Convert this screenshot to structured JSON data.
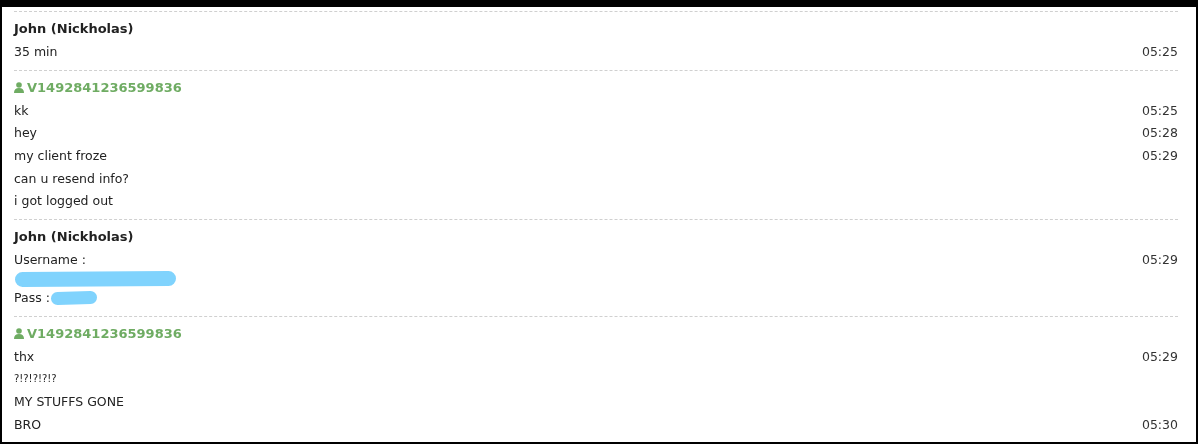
{
  "groups": [
    {
      "sender": "John (Nickholas)",
      "kind": "agent",
      "lines": [
        {
          "kind": "text",
          "text": "35 min",
          "time": "05:25"
        }
      ]
    },
    {
      "sender": "V1492841236599836",
      "kind": "visitor",
      "lines": [
        {
          "kind": "text",
          "text": "kk",
          "time": "05:25"
        },
        {
          "kind": "text",
          "text": "hey",
          "time": "05:28"
        },
        {
          "kind": "text",
          "text": "my client froze",
          "time": "05:29"
        },
        {
          "kind": "text",
          "text": "can u resend info?"
        },
        {
          "kind": "text",
          "text": "i got logged out"
        }
      ]
    },
    {
      "sender": "John (Nickholas)",
      "kind": "agent",
      "lines": [
        {
          "kind": "text",
          "text": "Username :",
          "time": "05:29"
        },
        {
          "kind": "redacted"
        },
        {
          "kind": "text",
          "text": "Pass :",
          "redacted": true
        }
      ]
    },
    {
      "sender": "V1492841236599836",
      "kind": "visitor",
      "lines": [
        {
          "kind": "text",
          "text": "thx",
          "time": "05:29"
        },
        {
          "kind": "text",
          "text": "?!?!?!?!?",
          "small": true
        },
        {
          "kind": "text",
          "text": "MY STUFFS GONE"
        },
        {
          "kind": "text",
          "text": "BRO",
          "time": "05:30"
        }
      ]
    }
  ]
}
